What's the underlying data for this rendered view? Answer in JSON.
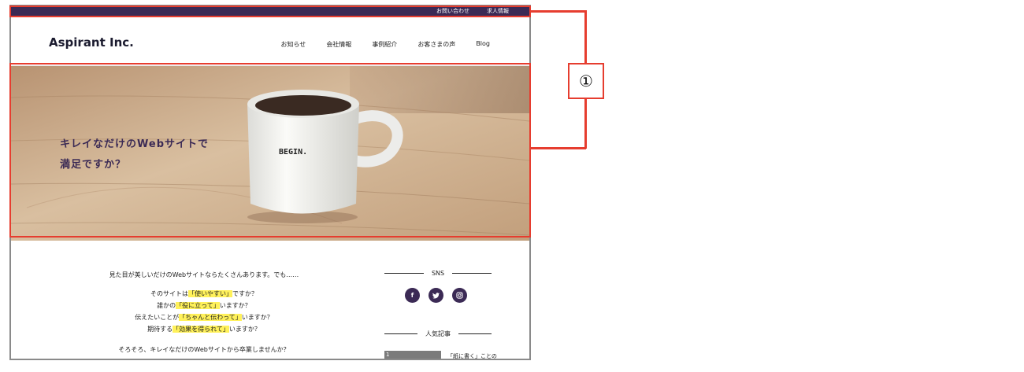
{
  "topbar": {
    "links": [
      "お問い合わせ",
      "求人情報"
    ]
  },
  "header": {
    "logo": "Aspirant Inc.",
    "nav": [
      "お知らせ",
      "会社情報",
      "事例紹介",
      "お客さまの声",
      "Blog"
    ]
  },
  "hero": {
    "lines": [
      "キレイなだけのWebサイトで",
      "満足ですか？"
    ],
    "mug_text": "BEGIN."
  },
  "content": {
    "intro": "見た目が美しいだけのWebサイトならたくさんあります。でも……",
    "q1": {
      "pre": "そのサイトは",
      "hl": "「使いやすい」",
      "post": "ですか？"
    },
    "q2": {
      "pre": "誰かの",
      "hl": "「役に立って」",
      "post": "いますか？"
    },
    "q3": {
      "pre": "伝えたいことが",
      "hl": "「ちゃんと伝わって」",
      "post": "いますか？"
    },
    "q4": {
      "pre": "期待する",
      "hl": "「効果を得られて」",
      "post": "いますか？"
    },
    "closing": "そろそろ、キレイなだけのWebサイトから卒業しませんか？"
  },
  "sidebar": {
    "sns_title": "SNS",
    "sns_icons": [
      "f",
      "t",
      "ig"
    ],
    "popular_title": "人気記事",
    "popular_item": {
      "rank": "1",
      "text": "「紙に書く」ことの"
    }
  },
  "annotation": {
    "number": "①"
  },
  "colors": {
    "brand": "#3b2a55",
    "highlight": "#fff15a",
    "annotation": "#e63d2f"
  }
}
